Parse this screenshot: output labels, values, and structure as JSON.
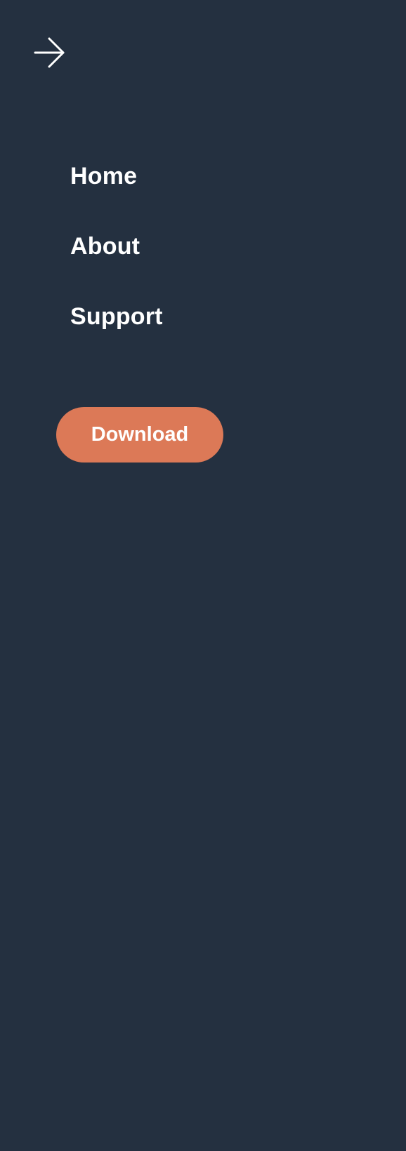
{
  "drawer": {
    "close_icon": "arrow-right-icon"
  },
  "nav": {
    "items": [
      {
        "label": "Home"
      },
      {
        "label": "About"
      },
      {
        "label": "Support"
      }
    ]
  },
  "cta": {
    "label": "Download"
  },
  "colors": {
    "background": "#243040",
    "accent": "#dc7957",
    "text": "#ffffff"
  }
}
